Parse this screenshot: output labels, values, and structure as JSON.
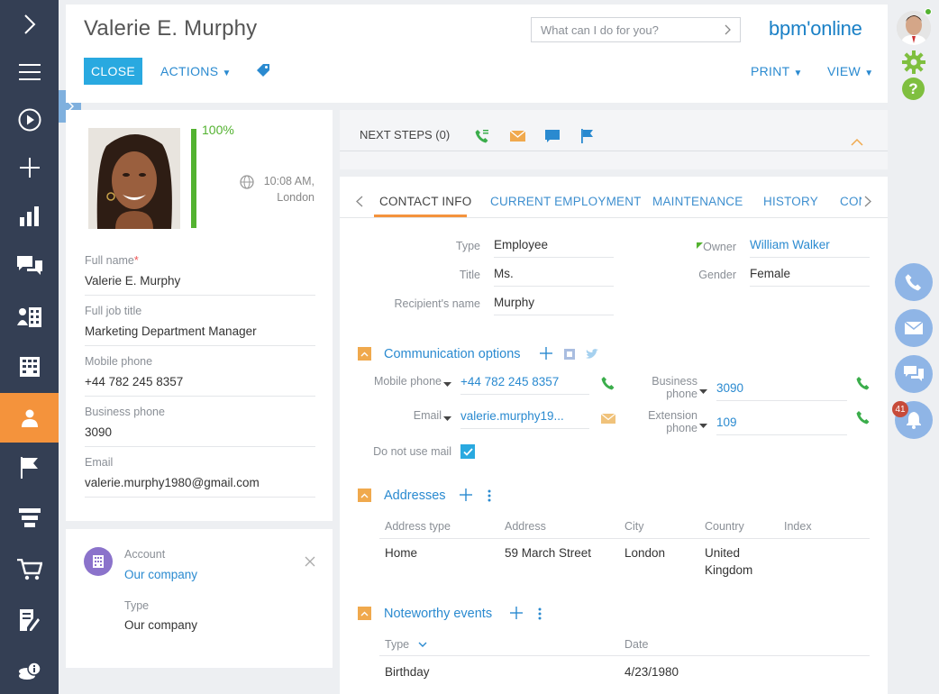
{
  "window": {
    "title": "Valerie E. Murphy"
  },
  "header": {
    "search_placeholder": "What can I do for you?",
    "logo_text": "bpm'online",
    "close_label": "CLOSE",
    "actions_label": "ACTIONS",
    "print_label": "PRINT",
    "view_label": "VIEW"
  },
  "profile": {
    "completeness": "100%",
    "time": "10:08 AM,",
    "location": "London",
    "fields": [
      {
        "label": "Full name",
        "value": "Valerie E. Murphy",
        "required": "*"
      },
      {
        "label": "Full job title",
        "value": "Marketing Department Manager"
      },
      {
        "label": "Mobile phone",
        "value": "+44 782 245 8357"
      },
      {
        "label": "Business phone",
        "value": "3090"
      },
      {
        "label": "Email",
        "value": "valerie.murphy1980@gmail.com"
      }
    ]
  },
  "account": {
    "label": "Account",
    "value": "Our company",
    "type_label": "Type",
    "type_value": "Our company"
  },
  "next_steps": {
    "label": "NEXT STEPS (0)"
  },
  "tabs": [
    "CONTACT INFO",
    "CURRENT EMPLOYMENT",
    "MAINTENANCE",
    "HISTORY",
    "CON"
  ],
  "contact_info": {
    "type_label": "Type",
    "type_value": "Employee",
    "title_label": "Title",
    "title_value": "Ms.",
    "recipient_label": "Recipient's name",
    "recipient_value": "Murphy",
    "owner_label": "Owner",
    "owner_value": "William Walker",
    "gender_label": "Gender",
    "gender_value": "Female"
  },
  "communication": {
    "title": "Communication options",
    "mobile_label": "Mobile phone",
    "mobile_value": "+44 782 245 8357",
    "email_label": "Email",
    "email_value": "valerie.murphy19...",
    "business_label_1": "Business",
    "business_label_2": "phone",
    "business_value": "3090",
    "extension_label_1": "Extension",
    "extension_label_2": "phone",
    "extension_value": "109",
    "donotmail_label": "Do not use mail"
  },
  "addresses": {
    "title": "Addresses",
    "columns": [
      "Address type",
      "Address",
      "City",
      "Country",
      "Index"
    ],
    "rows": [
      {
        "type": "Home",
        "address": "59 March Street",
        "city": "London",
        "country_1": "United",
        "country_2": "Kingdom",
        "index": ""
      }
    ]
  },
  "events": {
    "title": "Noteworthy events",
    "columns": [
      "Type",
      "Date"
    ],
    "rows": [
      {
        "type": "Birthday",
        "date": "4/23/1980"
      }
    ]
  },
  "rightbar": {
    "notification_count": "41"
  },
  "colors": {
    "sidebar": "#343f54",
    "accent": "#f4933c",
    "primary": "#29a9e0",
    "link": "#2a8ad0",
    "success": "#53b230",
    "right_icons": "#8fb5e6"
  }
}
